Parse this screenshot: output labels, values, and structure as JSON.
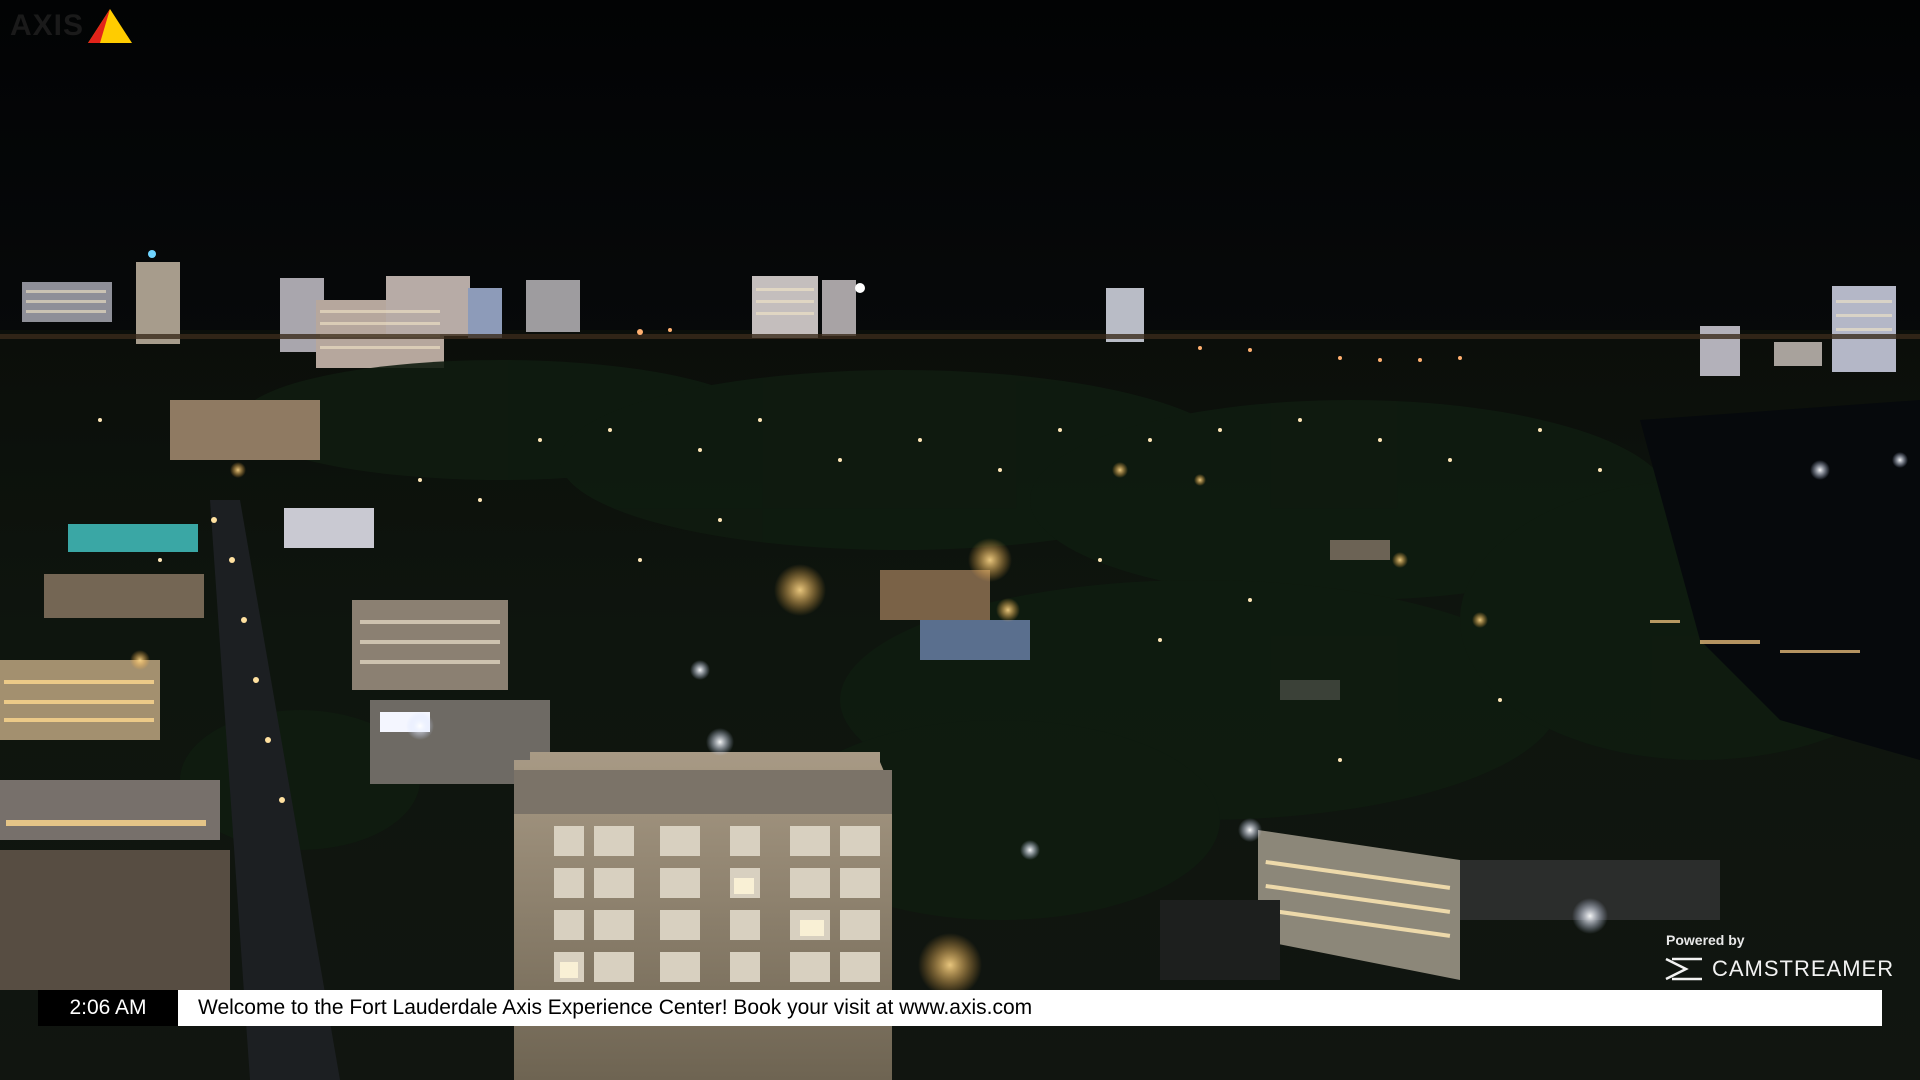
{
  "overlay": {
    "brand_logo_text": "AXIS",
    "brand_logo_icon": "axis-triangle-icon",
    "powered_by_label": "Powered by",
    "camstreamer_text": "CAMSTREAMER",
    "camstreamer_icon": "camstreamer-play-icon"
  },
  "ticker": {
    "clock": "2:06 AM",
    "message": "Welcome to the Fort Lauderdale Axis Experience Center! Book your visit at www.axis.com"
  },
  "colors": {
    "sky": "#040506",
    "city_dark": "#0b0f0b",
    "tree_dark": "#0e1a0f",
    "light_warm": "#ffd27a",
    "light_white": "#f4f6ff",
    "axis_yellow": "#ffcc00",
    "axis_red": "#e2231a"
  }
}
